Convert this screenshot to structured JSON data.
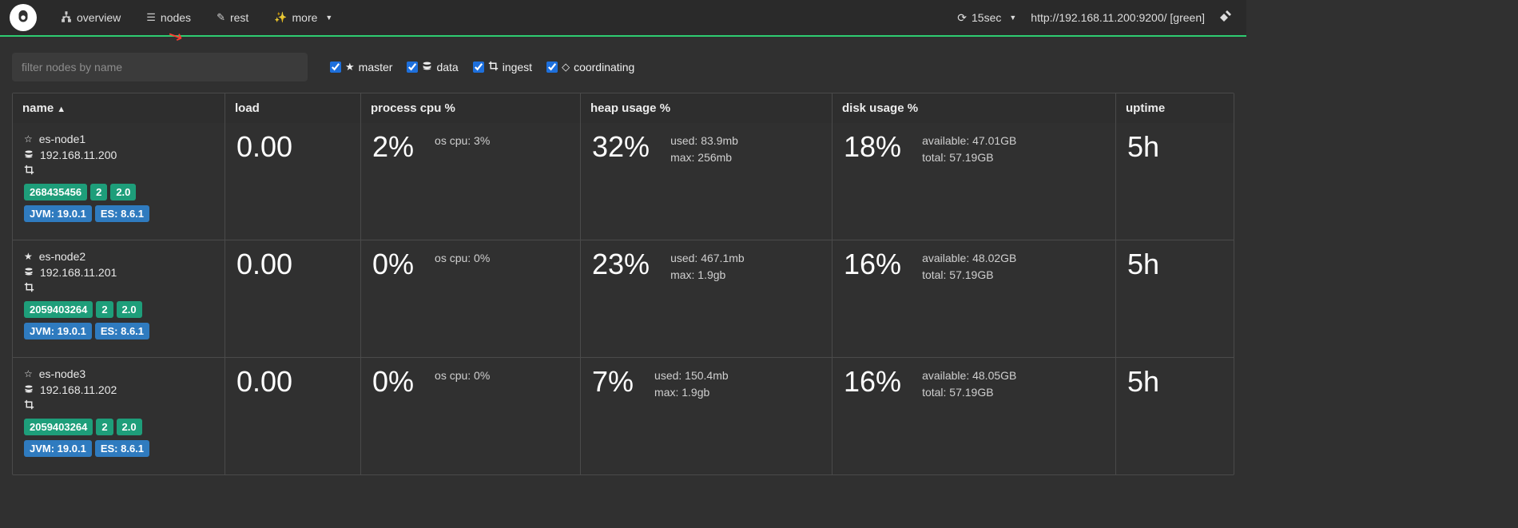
{
  "nav": {
    "overview": "overview",
    "nodes": "nodes",
    "rest": "rest",
    "more": "more"
  },
  "refresh": {
    "interval": "15sec"
  },
  "cluster": {
    "url": "http://192.168.11.200:9200/ [green]"
  },
  "filter": {
    "placeholder": "filter nodes by name"
  },
  "roles": {
    "master": "master",
    "data": "data",
    "ingest": "ingest",
    "coordinating": "coordinating"
  },
  "columns": {
    "name": "name",
    "load": "load",
    "cpu": "process cpu %",
    "heap": "heap usage %",
    "disk": "disk usage %",
    "uptime": "uptime"
  },
  "nodes": [
    {
      "name": "es-node1",
      "ip": "192.168.11.200",
      "master": false,
      "badges_green": [
        "268435456",
        "2",
        "2.0"
      ],
      "badges_blue": [
        "JVM: 19.0.1",
        "ES: 8.6.1"
      ],
      "load": "0.00",
      "cpu": "2%",
      "os_cpu": "os cpu: 3%",
      "heap": "32%",
      "heap_used": "used: 83.9mb",
      "heap_max": "max: 256mb",
      "disk": "18%",
      "disk_avail": "available: 47.01GB",
      "disk_total": "total: 57.19GB",
      "uptime": "5h"
    },
    {
      "name": "es-node2",
      "ip": "192.168.11.201",
      "master": true,
      "badges_green": [
        "2059403264",
        "2",
        "2.0"
      ],
      "badges_blue": [
        "JVM: 19.0.1",
        "ES: 8.6.1"
      ],
      "load": "0.00",
      "cpu": "0%",
      "os_cpu": "os cpu: 0%",
      "heap": "23%",
      "heap_used": "used: 467.1mb",
      "heap_max": "max: 1.9gb",
      "disk": "16%",
      "disk_avail": "available: 48.02GB",
      "disk_total": "total: 57.19GB",
      "uptime": "5h"
    },
    {
      "name": "es-node3",
      "ip": "192.168.11.202",
      "master": false,
      "badges_green": [
        "2059403264",
        "2",
        "2.0"
      ],
      "badges_blue": [
        "JVM: 19.0.1",
        "ES: 8.6.1"
      ],
      "load": "0.00",
      "cpu": "0%",
      "os_cpu": "os cpu: 0%",
      "heap": "7%",
      "heap_used": "used: 150.4mb",
      "heap_max": "max: 1.9gb",
      "disk": "16%",
      "disk_avail": "available: 48.05GB",
      "disk_total": "total: 57.19GB",
      "uptime": "5h"
    }
  ]
}
